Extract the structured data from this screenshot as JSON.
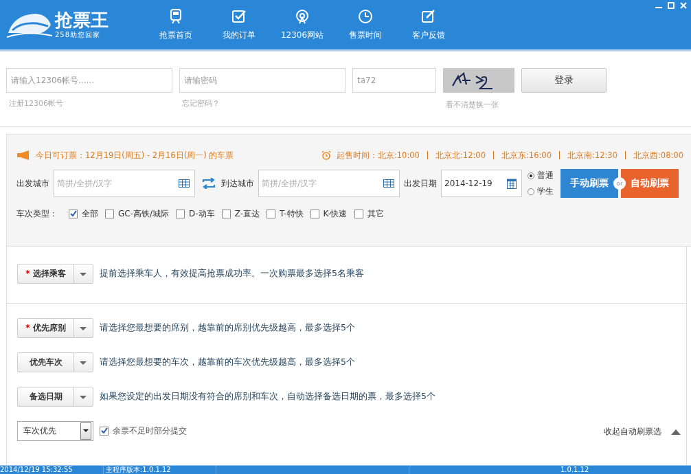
{
  "header": {
    "logo_title": "抢票王",
    "logo_subtitle": "258助您回家",
    "nav": [
      {
        "label": "抢票首页",
        "kind": "train"
      },
      {
        "label": "我的订单",
        "kind": "check"
      },
      {
        "label": "12306网站",
        "kind": "station"
      },
      {
        "label": "售票时间",
        "kind": "clock"
      },
      {
        "label": "客户反馈",
        "kind": "edit"
      }
    ]
  },
  "login": {
    "account": {
      "placeholder": "请输入12306帐号......"
    },
    "register_link": "注册12306帐号",
    "password": {
      "placeholder": "请输密码"
    },
    "forgot_link": "忘记密码？",
    "captcha": {
      "value": "ta72"
    },
    "refresh_hint": "看不清楚换一张",
    "login_button": "登录"
  },
  "notice": "今日可订票：12月19日(周五) - 2月16日(周一) 的车票",
  "sale_times": {
    "label": "起售时间：",
    "items": [
      "北京:10:00",
      "北京北:12:00",
      "北京东:16:00",
      "北京南:12:30",
      "北京西:08:00"
    ]
  },
  "search": {
    "from_label": "出发城市",
    "from_placeholder": "简拼/全拼/汉字",
    "to_label": "到达城市",
    "to_placeholder": "简拼/全拼/汉字",
    "date_label": "出发日期",
    "date_value": "2014-12-19",
    "ticket_types": [
      {
        "label": "普通",
        "selected": true
      },
      {
        "label": "学生",
        "selected": false
      }
    ],
    "manual_button": "手动刷票",
    "or_label": "or",
    "auto_button": "自动刷票"
  },
  "train_types": {
    "label": "车次类型：",
    "options": [
      {
        "label": "全部",
        "checked": true
      },
      {
        "label": "GC-高铁/城际",
        "checked": false
      },
      {
        "label": "D-动车",
        "checked": false
      },
      {
        "label": "Z-直达",
        "checked": false
      },
      {
        "label": "T-特快",
        "checked": false
      },
      {
        "label": "K-快速",
        "checked": false
      },
      {
        "label": "其它",
        "checked": false
      }
    ]
  },
  "required_mark": "*",
  "passenger": {
    "label": "选择乘客",
    "required": true,
    "hint": "提前选择乘车人，有效提高抢票成功率。一次购票最多选择5名乘客"
  },
  "preferences": [
    {
      "label": "优先席别",
      "required": true,
      "hint": "请选择您最想要的席别，越靠前的席别优先级越高，最多选择5个"
    },
    {
      "label": "优先车次",
      "required": false,
      "hint": "请选择您最想要的车次，越靠前的车次优先级越高，最多选择5个"
    },
    {
      "label": "备选日期",
      "required": false,
      "hint": "如果您设定的出发日期没有符合的席别和车次，自动选择备选日期的票，最多选择5个"
    }
  ],
  "priority_select": {
    "value": "车次优先"
  },
  "partial_submit": {
    "label": "余票不足时部分提交",
    "checked": true
  },
  "collapse_link": "收起自动刷票选",
  "status_bar": {
    "datetime": "2014/12/19 15:32:55",
    "main_version": "主程序版本:1.0.1.12",
    "version": "1.0.1.12"
  }
}
